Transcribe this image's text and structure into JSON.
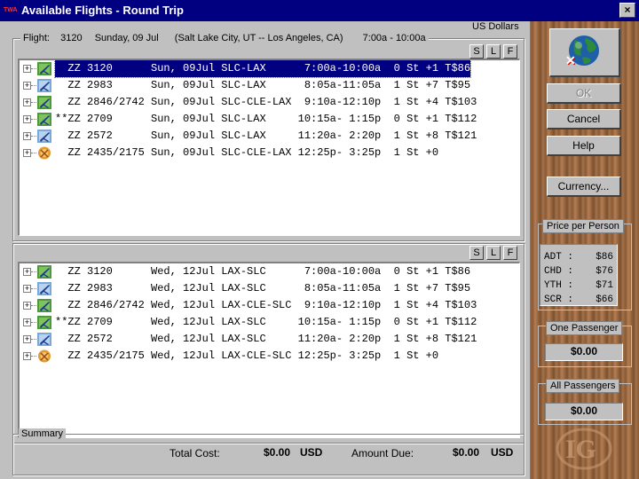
{
  "window": {
    "title": "Available Flights - Round Trip",
    "close_label": "×"
  },
  "currency_label": "US Dollars",
  "outbound": {
    "flight_prefix": "Flight:",
    "flight_no": "3120",
    "date": "Sunday, 09 Jul",
    "route": "(Salt Lake City, UT -- Los Angeles, CA)",
    "time": "7:00a - 10:00a",
    "buttons": [
      "S",
      "L",
      "F"
    ],
    "rows": [
      {
        "text": "  ZZ 3120      Sun, 09Jul SLC-LAX      7:00a-10:00a  0 St +1 T$86",
        "icon": "green"
      },
      {
        "text": "  ZZ 2983      Sun, 09Jul SLC-LAX      8:05a-11:05a  1 St +7 T$95",
        "icon": "blue"
      },
      {
        "text": "  ZZ 2846/2742 Sun, 09Jul SLC-CLE-LAX  9:10a-12:10p  1 St +4 T$103",
        "icon": "green"
      },
      {
        "text": "**ZZ 2709      Sun, 09Jul SLC-LAX     10:15a- 1:15p  0 St +1 T$112",
        "icon": "green"
      },
      {
        "text": "  ZZ 2572      Sun, 09Jul SLC-LAX     11:20a- 2:20p  1 St +8 T$121",
        "icon": "blue"
      },
      {
        "text": "  ZZ 2435/2175 Sun, 09Jul SLC-CLE-LAX 12:25p- 3:25p  1 St +0",
        "icon": "orange"
      }
    ]
  },
  "return": {
    "buttons": [
      "S",
      "L",
      "F"
    ],
    "rows": [
      {
        "text": "  ZZ 3120      Wed, 12Jul LAX-SLC      7:00a-10:00a  0 St +1 T$86",
        "icon": "green"
      },
      {
        "text": "  ZZ 2983      Wed, 12Jul LAX-SLC      8:05a-11:05a  1 St +7 T$95",
        "icon": "blue"
      },
      {
        "text": "  ZZ 2846/2742 Wed, 12Jul LAX-CLE-SLC  9:10a-12:10p  1 St +4 T$103",
        "icon": "green"
      },
      {
        "text": "**ZZ 2709      Wed, 12Jul LAX-SLC     10:15a- 1:15p  0 St +1 T$112",
        "icon": "green"
      },
      {
        "text": "  ZZ 2572      Wed, 12Jul LAX-SLC     11:20a- 2:20p  1 St +8 T$121",
        "icon": "blue"
      },
      {
        "text": "  ZZ 2435/2175 Wed, 12Jul LAX-CLE-SLC 12:25p- 3:25p  1 St +0",
        "icon": "orange"
      }
    ]
  },
  "summary": {
    "legend": "Summary",
    "total_cost_label": "Total Cost:",
    "total_cost_value": "$0.00",
    "total_cost_currency": "USD",
    "amount_due_label": "Amount Due:",
    "amount_due_value": "$0.00",
    "amount_due_currency": "USD"
  },
  "sidebar": {
    "ok_label": "OK",
    "cancel_label": "Cancel",
    "help_label": "Help",
    "currency_label": "Currency...",
    "price_title": "Price per Person",
    "prices": [
      {
        "code": "ADT :",
        "value": "$86"
      },
      {
        "code": "CHD :",
        "value": "$76"
      },
      {
        "code": "YTH :",
        "value": "$71"
      },
      {
        "code": "SCR :",
        "value": "$66"
      }
    ],
    "one_passenger_label": "One Passenger",
    "one_passenger_value": "$0.00",
    "all_passengers_label": "All Passengers",
    "all_passengers_value": "$0.00"
  },
  "colors": {
    "titlebar": "#000080",
    "selection": "#000080",
    "wood": "#8a5a35"
  }
}
